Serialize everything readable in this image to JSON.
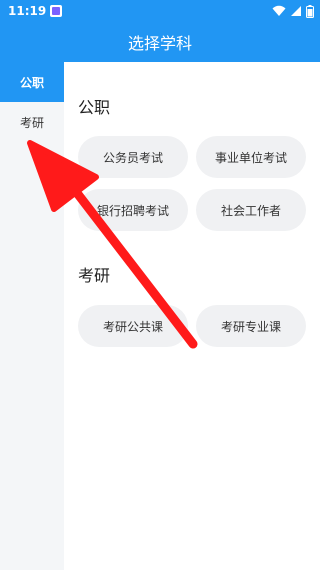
{
  "status_bar": {
    "time": "11:19"
  },
  "header": {
    "title": "选择学科"
  },
  "sidebar": {
    "items": [
      {
        "label": "公职",
        "active": true
      },
      {
        "label": "考研",
        "active": false
      }
    ]
  },
  "main": {
    "sections": [
      {
        "title": "公职",
        "options": [
          "公务员考试",
          "事业单位考试",
          "银行招聘考试",
          "社会工作者"
        ]
      },
      {
        "title": "考研",
        "options": [
          "考研公共课",
          "考研专业课"
        ]
      }
    ]
  },
  "annotation": {
    "type": "red-arrow",
    "points_to": "sidebar-item-kaoyan",
    "color": "#ff1a1a"
  },
  "colors": {
    "primary": "#2196f3",
    "chip_bg": "#f0f1f3",
    "sidebar_bg": "#f4f6f8"
  }
}
